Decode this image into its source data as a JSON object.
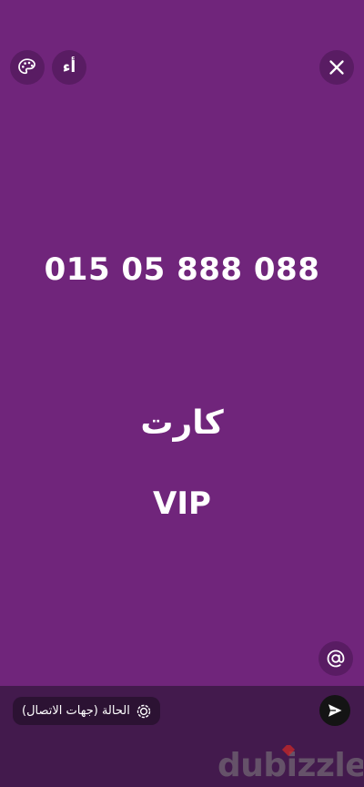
{
  "toolbar": {
    "font_button_label": "أء"
  },
  "status": {
    "phone_number": "015 05 888 088",
    "line_arabic": "كارت",
    "line_vip": "VIP"
  },
  "footer": {
    "privacy_label": "الحالة (جهات الاتصال)"
  },
  "watermark": {
    "text": "dubizzle"
  },
  "icons": {
    "palette": "palette-icon",
    "close": "close-icon",
    "mention": "at-sign-icon",
    "privacy": "status-ring-icon",
    "send": "send-icon"
  },
  "colors": {
    "background": "#70257b",
    "bottom_bar": "#431a4d",
    "send_button": "#141414",
    "text": "#ffffff"
  }
}
